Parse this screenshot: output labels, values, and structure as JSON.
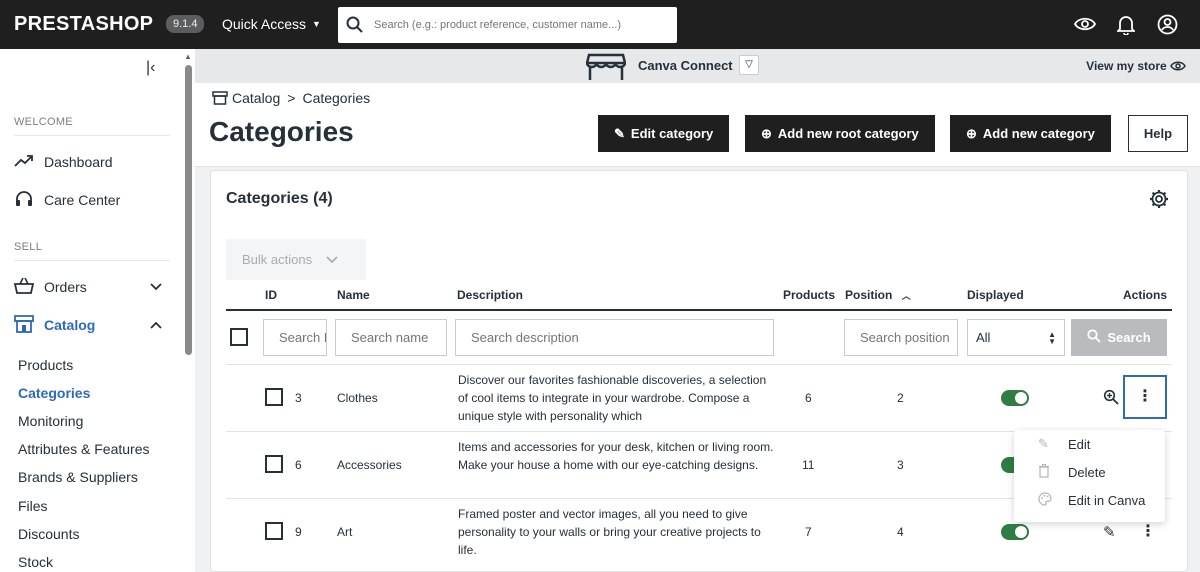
{
  "topbar": {
    "logo": "PRESTASHOP",
    "version": "9.1.4",
    "quick_access": "Quick Access",
    "search_placeholder": "Search (e.g.: product reference, customer name...)"
  },
  "sidebar": {
    "sections": {
      "welcome": "WELCOME",
      "sell": "SELL"
    },
    "items": {
      "dashboard": "Dashboard",
      "care_center": "Care Center",
      "orders": "Orders",
      "catalog": "Catalog"
    },
    "catalog_sub": {
      "products": "Products",
      "categories": "Categories",
      "monitoring": "Monitoring",
      "attributes": "Attributes & Features",
      "brands": "Brands & Suppliers",
      "files": "Files",
      "discounts": "Discounts",
      "stock": "Stock"
    }
  },
  "store": {
    "name": "Canva Connect",
    "view_store": "View my store"
  },
  "header": {
    "breadcrumb": {
      "parent": "Catalog",
      "current": "Categories"
    },
    "title": "Categories",
    "buttons": {
      "edit": "Edit category",
      "add_root": "Add new root category",
      "add": "Add new category",
      "help": "Help"
    }
  },
  "card": {
    "title": "Categories (4)",
    "bulk_actions": "Bulk actions",
    "columns": {
      "id": "ID",
      "name": "Name",
      "description": "Description",
      "products": "Products",
      "position": "Position",
      "displayed": "Displayed",
      "actions": "Actions"
    },
    "filters": {
      "id_placeholder": "Search ID",
      "name_placeholder": "Search name",
      "description_placeholder": "Search description",
      "position_placeholder": "Search position",
      "displayed_value": "All",
      "search_button": "Search"
    },
    "rows": [
      {
        "id": "3",
        "name": "Clothes",
        "description": "Discover our favorites fashionable discoveries, a selection of cool items to integrate in your wardrobe. Compose a unique style with personality which",
        "products": "6",
        "position": "2",
        "displayed": true
      },
      {
        "id": "6",
        "name": "Accessories",
        "description": "Items and accessories for your desk, kitchen or living room. Make your house a home with our eye-catching designs.",
        "products": "11",
        "position": "3",
        "displayed": true
      },
      {
        "id": "9",
        "name": "Art",
        "description": "Framed poster and vector images, all you need to give personality to your walls or bring your creative projects to life.",
        "products": "7",
        "position": "4",
        "displayed": true
      }
    ]
  },
  "dropdown": {
    "edit": "Edit",
    "delete": "Delete",
    "edit_canva": "Edit in Canva"
  },
  "colors": {
    "accent": "#2e6ab8",
    "toggle_on": "#2f7d44",
    "topbar": "#1f1f1f"
  }
}
